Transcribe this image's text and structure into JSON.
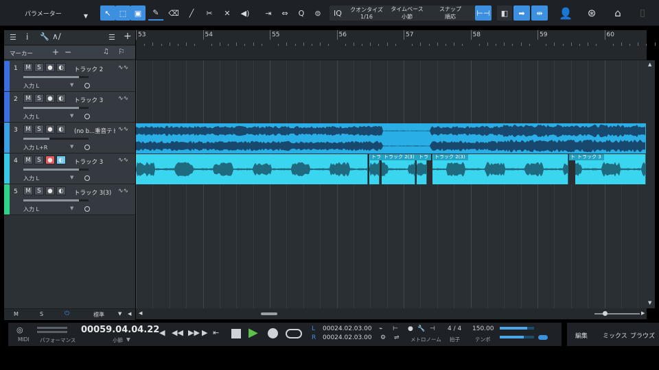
{
  "toolbar": {
    "param_label": "パラメーター",
    "quantize_label": "クオンタイズ",
    "quantize_value": "1/16",
    "timebase_label": "タイムベース",
    "timebase_value": "小節",
    "snap_label": "スナップ",
    "snap_value": "順応",
    "iq_label": "IQ",
    "q_label": "Q",
    "accent": "#3d8fe0"
  },
  "header": {
    "marker_label": "マーカー"
  },
  "ruler": {
    "bars": [
      "53",
      "54",
      "55",
      "56",
      "57",
      "58",
      "59",
      "60"
    ]
  },
  "tracks": [
    {
      "num": "1",
      "name": "トラック 2",
      "input": "入力 L",
      "color": "#3a6ee0",
      "vol": 0.85
    },
    {
      "num": "2",
      "name": "トラック 3",
      "input": "入力 L",
      "color": "#3a6ee0",
      "vol": 0.85
    },
    {
      "num": "3",
      "name": "(no b...重音テト",
      "input": "入力 L+R",
      "color": "#3aa0e8",
      "vol": 0.4
    },
    {
      "num": "4",
      "name": "トラック 3",
      "input": "入力 L",
      "color": "#3ac8e8",
      "vol": 0.85
    },
    {
      "num": "5",
      "name": "トラック 3(3)",
      "input": "入力 L",
      "color": "#2ed48a",
      "vol": 0.85
    }
  ],
  "clips": {
    "t4_labels": [
      "トラ",
      "トラック 2(3)",
      "トラ",
      "トラック 2(3)",
      "トラ",
      "トラック 3"
    ]
  },
  "bottom_left": {
    "m": "M",
    "s": "S",
    "std": "標準"
  },
  "transport": {
    "midi_label": "MIDI",
    "perf_label": "パフォーマンス",
    "position": "00059.04.04.22",
    "position_unit": "小節",
    "l_label": "L",
    "r_label": "R",
    "loop_l": "00024.02.03.00",
    "loop_r": "00024.02.03.00",
    "metronome_label": "メトロノーム",
    "sig_value": "4 / 4",
    "sig_label": "拍子",
    "tempo_value": "150.00",
    "tempo_label": "テンポ"
  },
  "view_buttons": [
    "編集",
    "ミックス",
    "ブラウズ"
  ]
}
